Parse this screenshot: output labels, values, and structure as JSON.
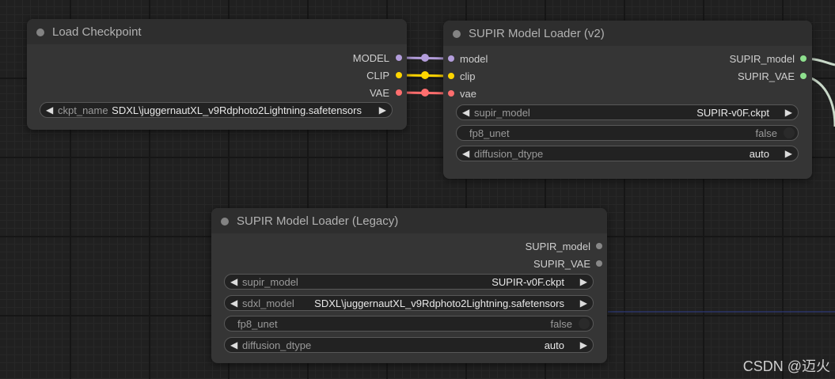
{
  "colors": {
    "model": "#b39ddb",
    "clip": "#ffd500",
    "vae": "#ff6e6e",
    "supir_out": "#8ee08e"
  },
  "load_checkpoint": {
    "title": "Load Checkpoint",
    "outputs": [
      "MODEL",
      "CLIP",
      "VAE"
    ],
    "ckpt_name": {
      "name": "ckpt_name",
      "value": "SDXL\\juggernautXL_v9Rdphoto2Lightning.safetensors"
    }
  },
  "supir_v2": {
    "title": "SUPIR Model Loader (v2)",
    "inputs": [
      "model",
      "clip",
      "vae"
    ],
    "outputs": [
      "SUPIR_model",
      "SUPIR_VAE"
    ],
    "supir_model": {
      "name": "supir_model",
      "value": "SUPIR-v0F.ckpt"
    },
    "fp8_unet": {
      "name": "fp8_unet",
      "value": "false"
    },
    "diffusion_dtype": {
      "name": "diffusion_dtype",
      "value": "auto"
    }
  },
  "supir_legacy": {
    "title": "SUPIR Model Loader (Legacy)",
    "outputs": [
      "SUPIR_model",
      "SUPIR_VAE"
    ],
    "supir_model": {
      "name": "supir_model",
      "value": "SUPIR-v0F.ckpt"
    },
    "sdxl_model": {
      "name": "sdxl_model",
      "value": "SDXL\\juggernautXL_v9Rdphoto2Lightning.safetensors"
    },
    "fp8_unet": {
      "name": "fp8_unet",
      "value": "false"
    },
    "diffusion_dtype": {
      "name": "diffusion_dtype",
      "value": "auto"
    }
  },
  "watermark": "CSDN @迈火"
}
